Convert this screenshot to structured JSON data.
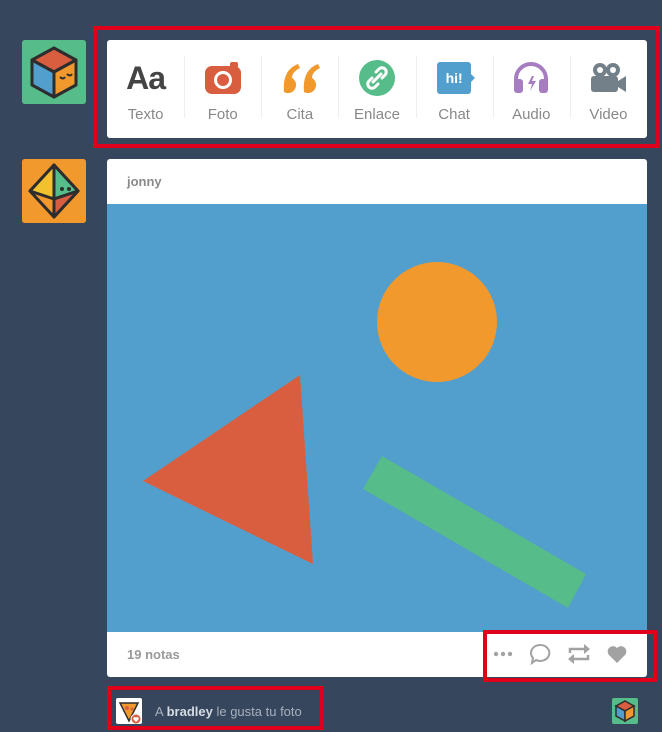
{
  "post_types": [
    {
      "id": "text",
      "label": "Texto",
      "glyph": "Aa",
      "icon": "text-icon",
      "color": "#444444"
    },
    {
      "id": "photo",
      "label": "Foto",
      "icon": "camera-icon",
      "color": "#d95e40"
    },
    {
      "id": "quote",
      "label": "Cita",
      "icon": "quote-icon",
      "color": "#f2992e"
    },
    {
      "id": "link",
      "label": "Enlace",
      "icon": "link-icon",
      "color": "#56bc8a"
    },
    {
      "id": "chat",
      "label": "Chat",
      "glyph": "hi!",
      "icon": "chat-icon",
      "color": "#529ecc"
    },
    {
      "id": "audio",
      "label": "Audio",
      "icon": "headphones-icon",
      "color": "#a77dc2"
    },
    {
      "id": "video",
      "label": "Video",
      "icon": "video-camera-icon",
      "color": "#748089"
    }
  ],
  "post": {
    "author": "jonny",
    "notes": "19 notas",
    "image_colors": {
      "background": "#529ecc",
      "circle": "#f2992e",
      "triangle": "#d95e40",
      "bar": "#56bc8a"
    }
  },
  "notification": {
    "prefix": "A",
    "user": "bradley",
    "suffix": "le gusta tu foto"
  },
  "colors": {
    "dashboard_bg": "#36465d",
    "highlight": "#e0001b"
  }
}
